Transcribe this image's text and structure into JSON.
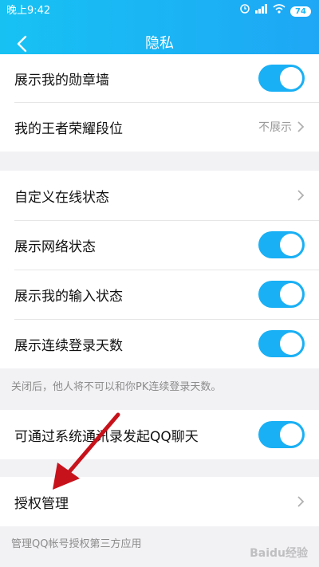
{
  "status_bar": {
    "time": "晚上9:42",
    "battery": "74"
  },
  "header": {
    "title": "隐私"
  },
  "rows": {
    "medal_wall": "展示我的勋章墙",
    "honor_rank": "我的王者荣耀段位",
    "honor_rank_value": "不展示",
    "custom_online": "自定义在线状态",
    "network_status": "展示网络状态",
    "input_status": "展示我的输入状态",
    "login_days": "展示连续登录天数",
    "login_days_hint": "关闭后，他人将不可以和你PK连续登录天数。",
    "contacts_chat": "可通过系统通讯录发起QQ聊天",
    "auth_manage": "授权管理",
    "auth_manage_hint": "管理QQ帐号授权第三方应用"
  },
  "toggles": {
    "medal_wall": true,
    "network_status": true,
    "input_status": true,
    "login_days": true,
    "contacts_chat": true
  },
  "watermark": "Baidu经验",
  "colors": {
    "header_start": "#17c2f3",
    "header_end": "#1ea7f5",
    "toggle_on": "#19b0f5",
    "annotation_arrow": "#c8121b"
  },
  "icons": [
    "back-arrow-icon",
    "chevron-right-icon",
    "signal-icon",
    "wifi-icon",
    "alarm-icon",
    "battery-icon",
    "annotation-arrow"
  ]
}
